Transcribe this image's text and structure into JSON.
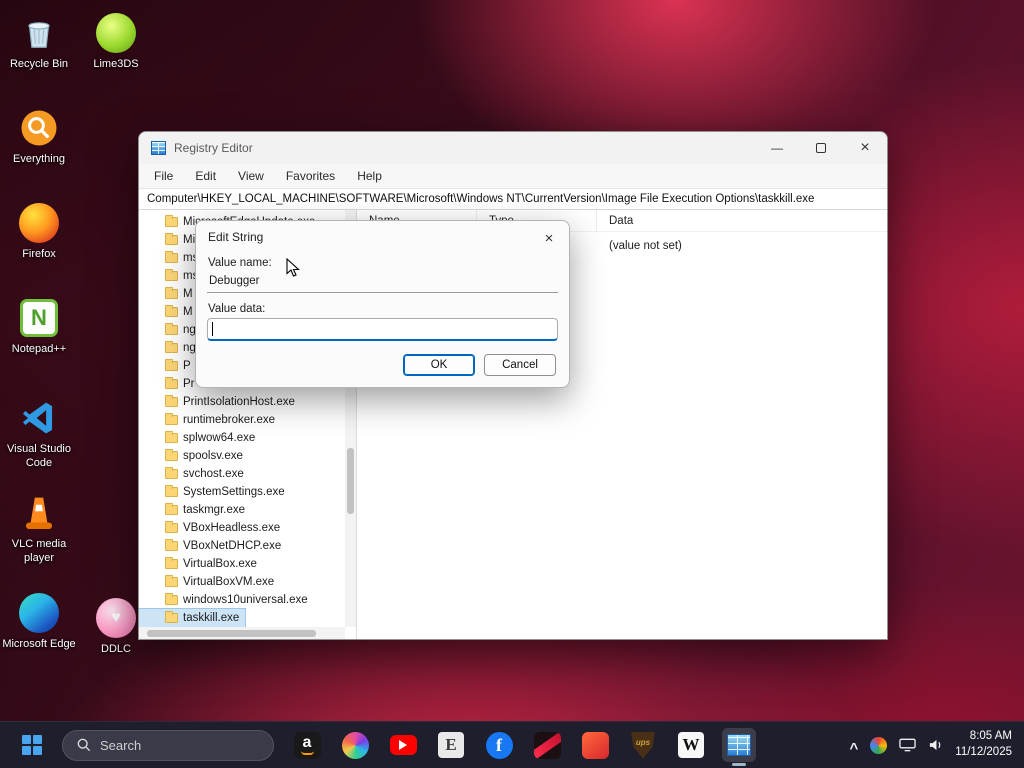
{
  "desktop": {
    "icons": [
      {
        "label": "Recycle Bin"
      },
      {
        "label": "Lime3DS"
      },
      {
        "label": "Everything"
      },
      {
        "label": "Firefox"
      },
      {
        "label": "Notepad++"
      },
      {
        "label": "Visual Studio Code"
      },
      {
        "label": "VLC media player"
      },
      {
        "label": "Microsoft Edge"
      },
      {
        "label": "DDLC"
      }
    ],
    "notepad_glyph": "N",
    "ddlc_glyph": "♥"
  },
  "window": {
    "title": "Registry Editor",
    "controls": {
      "minimize": "—",
      "close": "×"
    },
    "menu": [
      "File",
      "Edit",
      "View",
      "Favorites",
      "Help"
    ],
    "address": "Computer\\HKEY_LOCAL_MACHINE\\SOFTWARE\\Microsoft\\Windows NT\\CurrentVersion\\Image File Execution Options\\taskkill.exe",
    "columns": [
      "Name",
      "Type",
      "Data"
    ],
    "data_cell": "(value not set)",
    "tree_items": [
      "MicrosoftEdgeUpdate.exe",
      "Mi",
      "ms",
      "ms",
      "M",
      "M",
      "ng",
      "ng",
      "P",
      "Pr",
      "PrintIsolationHost.exe",
      "runtimebroker.exe",
      "splwow64.exe",
      "spoolsv.exe",
      "svchost.exe",
      "SystemSettings.exe",
      "taskmgr.exe",
      "VBoxHeadless.exe",
      "VBoxNetDHCP.exe",
      "VirtualBox.exe",
      "VirtualBoxVM.exe",
      "windows10universal.exe",
      "taskkill.exe"
    ]
  },
  "dialog": {
    "title": "Edit String",
    "close": "×",
    "value_name_label": "Value name:",
    "value_name": "Debugger",
    "value_data_label": "Value data:",
    "value_data": "",
    "ok_label": "OK",
    "cancel_label": "Cancel"
  },
  "taskbar": {
    "search_placeholder": "Search",
    "apps": [
      {
        "name": "amazon",
        "glyph": "a"
      },
      {
        "name": "photos",
        "glyph": ""
      },
      {
        "name": "youtube",
        "glyph": ""
      },
      {
        "name": "e-app",
        "glyph": "E"
      },
      {
        "name": "facebook",
        "glyph": "f"
      },
      {
        "name": "red-app",
        "glyph": ""
      },
      {
        "name": "orange-app",
        "glyph": ""
      },
      {
        "name": "ups",
        "glyph": "ups"
      },
      {
        "name": "wikipedia",
        "glyph": "W"
      },
      {
        "name": "registry-editor",
        "glyph": ""
      }
    ],
    "tray": {
      "chevron": "^",
      "time": "8:05 AM",
      "date": "11/12/2025"
    }
  },
  "colors": {
    "accent": "#0067c0",
    "selection": "#cde4f7",
    "taskbar_bg": "#1e1e2d"
  }
}
